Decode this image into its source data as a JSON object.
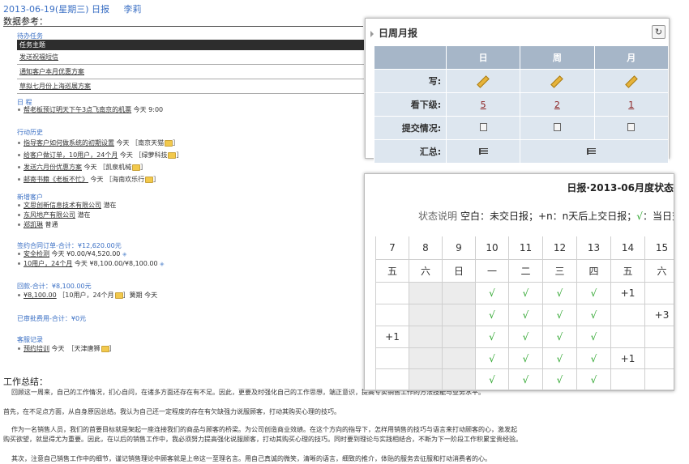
{
  "header": {
    "date": "2013-06-19(星期三) 日报",
    "user": "李莉"
  },
  "ref_title": "数据参考：",
  "tasks": {
    "title": "待办任务",
    "head": "任务主题",
    "rows": [
      "发送祝福短信",
      "通知客户本月优惠方案",
      "草拟七月份上海巡展方案"
    ]
  },
  "schedule": {
    "title": "日 程",
    "item": "帮老板预订明天下午3点飞南京的机票",
    "time": "今天 9:00"
  },
  "history": {
    "title": "行动历史",
    "items": [
      {
        "text": "指导客户如何做系统的初期设置",
        "tail": "今天 ［南京天猫"
      },
      {
        "text": "给客户做订单，10用户，24个月",
        "tail": "今天 ［绿萝科技"
      },
      {
        "text": "发送六月份优惠方案",
        "tail": "今天 ［凯泉机械"
      },
      {
        "text": "邮寄书籍《老板不忙》",
        "tail": "今天 ［海南欢乐行"
      }
    ]
  },
  "new_clients": {
    "title": "新增客户",
    "items": [
      {
        "name": "文思创新信息技术有限公司",
        "tag": "潜在"
      },
      {
        "name": "东风地产有限公司",
        "tag": "潜在"
      },
      {
        "name": "郑凯琳",
        "tag": "普通"
      }
    ]
  },
  "contracts": {
    "title": "签约合同订单-合计：¥12,620.00元",
    "items": [
      {
        "name": "安全检测",
        "tail": "今天 ¥0.00/¥4,520.00"
      },
      {
        "name": "10用户，24个月",
        "tail": "今天 ¥8,100.00/¥8,100.00"
      }
    ]
  },
  "payments": {
    "title": "回款-合计：¥8,100.00元",
    "amount": "¥8,100.00",
    "detail": "［10用户，24个月",
    "tail": "］簧期 今天"
  },
  "expenses": {
    "title": "已审批费用-合计：¥0元"
  },
  "visits": {
    "title": "客服记录",
    "name": "预约培训",
    "tail": "今天　［天津唐狮"
  },
  "summary": {
    "title": "工作总结：",
    "p1": "回顾这一周来，自己的工作情况，扪心自问，在诸多方面还存在有不足。因此，更要及时强化自己的工作思想，端正意识，提高专卖销售工作的方法技能与业务水平。",
    "p2": "首先，在不足点方面，从自身原因总结。我认为自己还一定程度的存在有欠缺强力说服顾客，打动其购买心理的技巧。",
    "p3": "作为一名销售人员，我们的首要目标就是架起一座连接我们的商品与顾客的桥梁。为公司创造商业效绩。在这个方向的指导下，怎样用销售的技巧与语言来打动顾客的心，激发起购买欲望，就显得尤为重要。因此，在以后的销售工作中，我必须努力提高强化说服顾客，打动其购买心理的技巧。同时要到理论与实践相结合，不断为下一阶段工作积累宝贵经验。",
    "p4": "其次，注意自己销售工作中的细节，谨记销售理论中顾客就是上帝这一至理名言。用自己真诚的微笑，清晰的语言，细致的推介，体贴的服务去征服和打动消费者的心。"
  },
  "weekly": {
    "title": "日周月报",
    "cols": [
      "日",
      "周",
      "月"
    ],
    "rows": {
      "write": "写:",
      "sub": "看下级:",
      "submit": "提交情况:",
      "total": "汇总:"
    },
    "sub_counts": [
      "5",
      "2",
      "1"
    ]
  },
  "monthly": {
    "title": "日报·2013-06月度状态",
    "legend_label": "状态说明",
    "legend_text": "空白：未交日报；+n：n天后上交日报；",
    "legend_check": "√",
    "legend_tail": "：当日交",
    "days": [
      "7",
      "8",
      "9",
      "10",
      "11",
      "12",
      "13",
      "14",
      "15"
    ],
    "weekdays": [
      "五",
      "六",
      "日",
      "一",
      "二",
      "三",
      "四",
      "五",
      "六"
    ],
    "rows": [
      [
        "",
        "",
        "",
        "√",
        "√",
        "√",
        "√",
        "+1",
        ""
      ],
      [
        "",
        "",
        "",
        "√",
        "√",
        "√",
        "√",
        "",
        "+3"
      ],
      [
        "+1",
        "",
        "",
        "√",
        "√",
        "√",
        "√",
        "",
        ""
      ],
      [
        "",
        "",
        "",
        "√",
        "√",
        "√",
        "√",
        "+1",
        ""
      ],
      [
        "",
        "",
        "",
        "√",
        "√",
        "√",
        "√",
        "",
        ""
      ]
    ]
  },
  "colors": {
    "link": "#3a6fc4",
    "check": "#2ea62e",
    "header_cell": "#a6b6c8",
    "row_cell": "#dde6ef"
  }
}
